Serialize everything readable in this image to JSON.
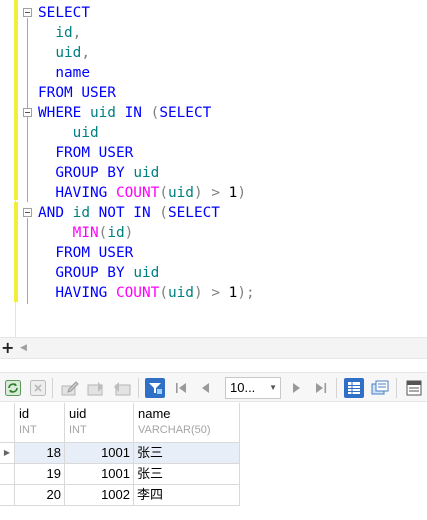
{
  "editor": {
    "lines": [
      [
        {
          "t": "SELECT",
          "c": "kw"
        }
      ],
      [
        {
          "t": "  "
        },
        {
          "t": "id",
          "c": "id"
        },
        {
          "t": ",",
          "c": "pn"
        }
      ],
      [
        {
          "t": "  "
        },
        {
          "t": "uid",
          "c": "id"
        },
        {
          "t": ",",
          "c": "pn"
        }
      ],
      [
        {
          "t": "  "
        },
        {
          "t": "name",
          "c": "kw"
        }
      ],
      [
        {
          "t": "FROM USER",
          "c": "kw"
        }
      ],
      [
        {
          "t": "WHERE ",
          "c": "kw"
        },
        {
          "t": "uid",
          "c": "id"
        },
        {
          "t": " IN ",
          "c": "kw"
        },
        {
          "t": "(",
          "c": "pn"
        },
        {
          "t": "SELECT",
          "c": "kw"
        }
      ],
      [
        {
          "t": "    "
        },
        {
          "t": "uid",
          "c": "id"
        }
      ],
      [
        {
          "t": "  FROM USER",
          "c": "kw"
        }
      ],
      [
        {
          "t": "  GROUP BY ",
          "c": "kw"
        },
        {
          "t": "uid",
          "c": "id"
        }
      ],
      [
        {
          "t": "  HAVING ",
          "c": "kw"
        },
        {
          "t": "COUNT",
          "c": "fn"
        },
        {
          "t": "(",
          "c": "pn"
        },
        {
          "t": "uid",
          "c": "id"
        },
        {
          "t": ")",
          "c": "pn"
        },
        {
          "t": " > ",
          "c": "pn"
        },
        {
          "t": "1",
          "c": "nm"
        },
        {
          "t": ")",
          "c": "pn"
        }
      ],
      [
        {
          "t": "AND ",
          "c": "kw"
        },
        {
          "t": "id",
          "c": "id"
        },
        {
          "t": " NOT IN ",
          "c": "kw"
        },
        {
          "t": "(",
          "c": "pn"
        },
        {
          "t": "SELECT",
          "c": "kw"
        }
      ],
      [
        {
          "t": "    "
        },
        {
          "t": "MIN",
          "c": "fn"
        },
        {
          "t": "(",
          "c": "pn"
        },
        {
          "t": "id",
          "c": "id"
        },
        {
          "t": ")",
          "c": "pn"
        }
      ],
      [
        {
          "t": "  FROM USER",
          "c": "kw"
        }
      ],
      [
        {
          "t": "  GROUP BY ",
          "c": "kw"
        },
        {
          "t": "uid",
          "c": "id"
        }
      ],
      [
        {
          "t": "  HAVING ",
          "c": "kw"
        },
        {
          "t": "COUNT",
          "c": "fn"
        },
        {
          "t": "(",
          "c": "pn"
        },
        {
          "t": "uid",
          "c": "id"
        },
        {
          "t": ")",
          "c": "pn"
        },
        {
          "t": " > ",
          "c": "pn"
        },
        {
          "t": "1",
          "c": "nm"
        },
        {
          "t": ");",
          "c": "pn"
        }
      ]
    ]
  },
  "toolbar": {
    "rows_value": "10...",
    "icons": [
      "refresh-icon",
      "stop-icon",
      "edit-icon",
      "save-icon",
      "discard-icon",
      "filter-icon",
      "first-page-icon",
      "prev-page-icon",
      "rows-dropdown",
      "next-page-icon",
      "last-page-icon",
      "grid-view-icon",
      "form-view-icon",
      "text-view-icon"
    ]
  },
  "result": {
    "columns": [
      {
        "name": "id",
        "type": "INT"
      },
      {
        "name": "uid",
        "type": "INT"
      },
      {
        "name": "name",
        "type": "VARCHAR(50)"
      }
    ],
    "rows": [
      [
        "18",
        "1001",
        "张三"
      ],
      [
        "19",
        "1001",
        "张三"
      ],
      [
        "20",
        "1002",
        "李四"
      ]
    ],
    "selected_row": 0
  },
  "colors": {
    "keyword": "#0000ff",
    "identifier": "#008080",
    "function": "#ff00ff",
    "punctuation": "#808080",
    "change_marker": "#f2ee3c",
    "selected_row_bg": "#e8eef8"
  }
}
